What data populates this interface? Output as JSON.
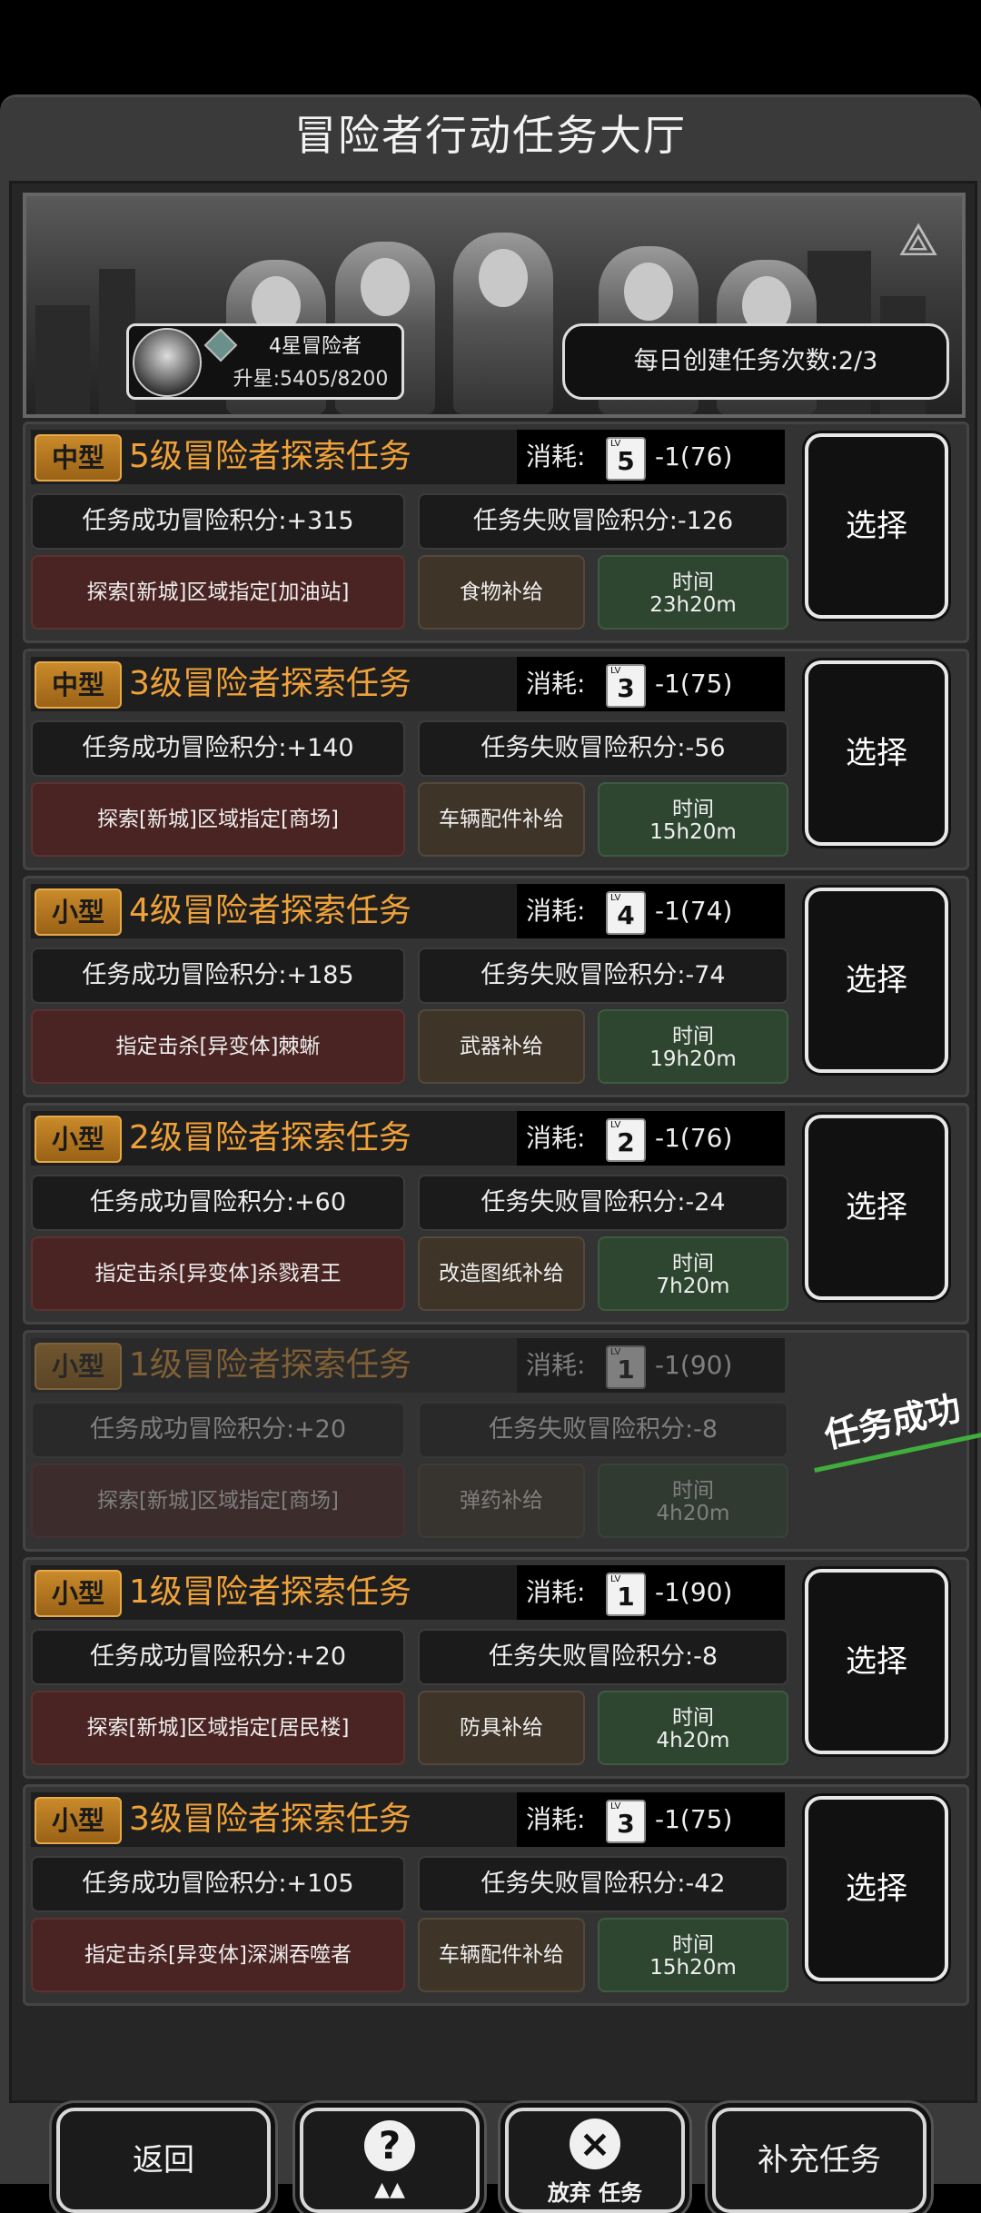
{
  "title": "冒险者行动任务大厅",
  "player": {
    "rank": "4星冒险者",
    "upgrade": "升星:5405/8200",
    "daily": "每日创建任务次数:2/3"
  },
  "labels": {
    "cost": "消耗:",
    "lv": "LV",
    "time": "时间",
    "select": "选择",
    "success_stamp": "任务成功"
  },
  "missions": [
    {
      "size": "中型",
      "name": "5级冒险者探索任务",
      "level": "5",
      "cost": "-1(76)",
      "success": "任务成功冒险积分:+315",
      "fail": "任务失败冒险积分:-126",
      "target": "探索[新城]区域指定[加油站]",
      "supply": "食物补给",
      "time": "23h20m",
      "done": false
    },
    {
      "size": "中型",
      "name": "3级冒险者探索任务",
      "level": "3",
      "cost": "-1(75)",
      "success": "任务成功冒险积分:+140",
      "fail": "任务失败冒险积分:-56",
      "target": "探索[新城]区域指定[商场]",
      "supply": "车辆配件补给",
      "time": "15h20m",
      "done": false
    },
    {
      "size": "小型",
      "name": "4级冒险者探索任务",
      "level": "4",
      "cost": "-1(74)",
      "success": "任务成功冒险积分:+185",
      "fail": "任务失败冒险积分:-74",
      "target": "指定击杀[异变体]棘蜥",
      "supply": "武器补给",
      "time": "19h20m",
      "done": false
    },
    {
      "size": "小型",
      "name": "2级冒险者探索任务",
      "level": "2",
      "cost": "-1(76)",
      "success": "任务成功冒险积分:+60",
      "fail": "任务失败冒险积分:-24",
      "target": "指定击杀[异变体]杀戮君王",
      "supply": "改造图纸补给",
      "time": "7h20m",
      "done": false
    },
    {
      "size": "小型",
      "name": "1级冒险者探索任务",
      "level": "1",
      "cost": "-1(90)",
      "success": "任务成功冒险积分:+20",
      "fail": "任务失败冒险积分:-8",
      "target": "探索[新城]区域指定[商场]",
      "supply": "弹药补给",
      "time": "4h20m",
      "done": true
    },
    {
      "size": "小型",
      "name": "1级冒险者探索任务",
      "level": "1",
      "cost": "-1(90)",
      "success": "任务成功冒险积分:+20",
      "fail": "任务失败冒险积分:-8",
      "target": "探索[新城]区域指定[居民楼]",
      "supply": "防具补给",
      "time": "4h20m",
      "done": false
    },
    {
      "size": "小型",
      "name": "3级冒险者探索任务",
      "level": "3",
      "cost": "-1(75)",
      "success": "任务成功冒险积分:+105",
      "fail": "任务失败冒险积分:-42",
      "target": "指定击杀[异变体]深渊吞噬者",
      "supply": "车辆配件补给",
      "time": "15h20m",
      "done": false
    }
  ],
  "buttons": {
    "back": "返回",
    "abandon": "放弃 任务",
    "refill": "补充任务"
  },
  "icons": {
    "help": "question-map-icon",
    "abandon": "close-circle-icon"
  }
}
